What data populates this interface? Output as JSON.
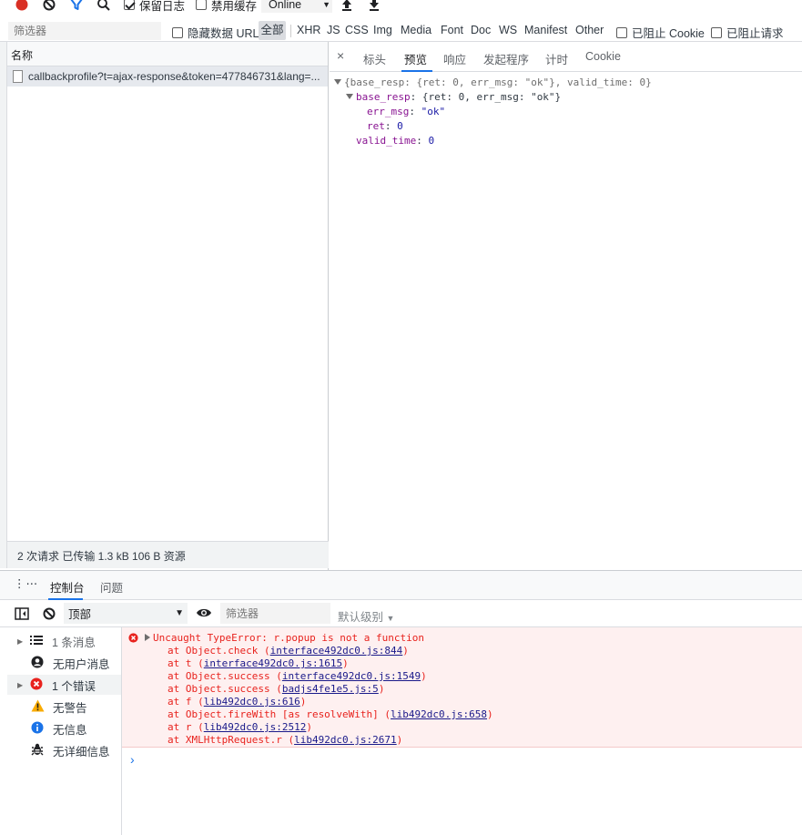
{
  "toolbar": {
    "preserve_log": "保留日志",
    "disable_cache": "禁用缓存",
    "throttle": "Online"
  },
  "filter": {
    "placeholder": "筛选器",
    "hide_data_urls": "隐藏数据 URL",
    "types": [
      "全部",
      "XHR",
      "JS",
      "CSS",
      "Img",
      "Media",
      "Font",
      "Doc",
      "WS",
      "Manifest",
      "Other"
    ],
    "blocked_cookies": "已阻止 Cookie",
    "blocked_requests": "已阻止请求"
  },
  "request_list": {
    "header": "名称",
    "rows": [
      "callbackprofile?t=ajax-response&token=477846731&lang=..."
    ],
    "summary": "2 次请求  已传输 1.3 kB  106 B 资源"
  },
  "detail": {
    "tabs": [
      "标头",
      "预览",
      "响应",
      "发起程序",
      "计时",
      "Cookie"
    ],
    "active_tab": "预览",
    "preview": {
      "root": "{base_resp: {ret: 0, err_msg: \"ok\"}, valid_time: 0}",
      "base_resp_key": "base_resp",
      "base_resp_value": "{ret: 0, err_msg: \"ok\"}",
      "err_msg_key": "err_msg",
      "err_msg_value": "\"ok\"",
      "ret_key": "ret",
      "ret_value": "0",
      "valid_time_key": "valid_time",
      "valid_time_value": "0"
    }
  },
  "drawer": {
    "tabs": [
      "控制台",
      "问题"
    ],
    "context": "顶部",
    "filter_placeholder": "筛选器",
    "levels": "默认级别"
  },
  "sidebar": {
    "items": [
      {
        "label": "1 条消息",
        "icon": "list-icon"
      },
      {
        "label": "无用户消息",
        "icon": "user-icon"
      },
      {
        "label": "1 个错误",
        "icon": "error-icon"
      },
      {
        "label": "无警告",
        "icon": "warning-icon"
      },
      {
        "label": "无信息",
        "icon": "info-icon"
      },
      {
        "label": "无详细信息",
        "icon": "bug-icon"
      }
    ]
  },
  "console": {
    "error_title": "Uncaught TypeError: r.popup is not a function",
    "stack": [
      {
        "prefix": "at Object.check (",
        "link": "interface492dc0.js:844",
        "suffix": ")"
      },
      {
        "prefix": "at t (",
        "link": "interface492dc0.js:1615",
        "suffix": ")"
      },
      {
        "prefix": "at Object.success (",
        "link": "interface492dc0.js:1549",
        "suffix": ")"
      },
      {
        "prefix": "at Object.success (",
        "link": "badjs4fe1e5.js:5",
        "suffix": ")"
      },
      {
        "prefix": "at f (",
        "link": "lib492dc0.js:616",
        "suffix": ")"
      },
      {
        "prefix": "at Object.fireWith [as resolveWith] (",
        "link": "lib492dc0.js:658",
        "suffix": ")"
      },
      {
        "prefix": "at r (",
        "link": "lib492dc0.js:2512",
        "suffix": ")"
      },
      {
        "prefix": "at XMLHttpRequest.r (",
        "link": "lib492dc0.js:2671",
        "suffix": ")"
      }
    ]
  },
  "colors": {
    "accent": "#1a73e8",
    "error": "#e8221d",
    "record": "#d93025",
    "warning": "#f9ab00"
  }
}
